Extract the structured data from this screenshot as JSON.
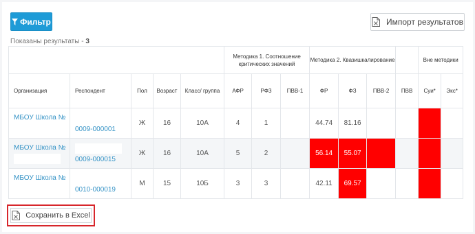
{
  "toolbar": {
    "filter_label": "Фильтр",
    "import_label": "Импорт результатов",
    "save_label": "Сохранить в Excel"
  },
  "results": {
    "prefix": "Показаны результаты -",
    "count": "3"
  },
  "table": {
    "groups": {
      "method1": "Методика 1. Соотношение критических значений",
      "method2": "Методика 2. Квазишкалирование",
      "outside": "Вне методики"
    },
    "columns": {
      "org": "Организация",
      "respondent": "Респондент",
      "sex": "Пол",
      "age": "Возраст",
      "class": "Класс/ группа",
      "afr": "АФР",
      "rfz": "РФЗ",
      "pvv1": "ПВВ-1",
      "fr": "ФР",
      "fz": "ФЗ",
      "pvv2": "ПВВ-2",
      "pvv": "ПВВ",
      "sui": "Суи*",
      "eks": "Экс*"
    },
    "rows": [
      {
        "org": "МБОУ Школа №",
        "respondent": "0009-000001",
        "sex": "Ж",
        "age": "16",
        "class": "10А",
        "afr": "4",
        "rfz": "1",
        "pvv1": "",
        "fr": "44.74",
        "fz": "81.16",
        "pvv2": "",
        "pvv": "",
        "sui": "",
        "eks": ""
      },
      {
        "org": "МБОУ Школа №",
        "respondent": "0009-000015",
        "sex": "Ж",
        "age": "16",
        "class": "10А",
        "afr": "5",
        "rfz": "2",
        "pvv1": "",
        "fr": "56.14",
        "fz": "55.07",
        "pvv2": "",
        "pvv": "",
        "sui": "",
        "eks": ""
      },
      {
        "org": "МБОУ Школа №",
        "respondent": "0010-000019",
        "sex": "М",
        "age": "15",
        "class": "10Б",
        "afr": "3",
        "rfz": "3",
        "pvv1": "",
        "fr": "42.11",
        "fz": "69.57",
        "pvv2": "",
        "pvv": "",
        "sui": "",
        "eks": ""
      }
    ]
  },
  "colors": {
    "accent": "#1e9bd7",
    "link": "#3593c6",
    "highlight": "#ff0000",
    "save_outline": "#d7262b"
  }
}
